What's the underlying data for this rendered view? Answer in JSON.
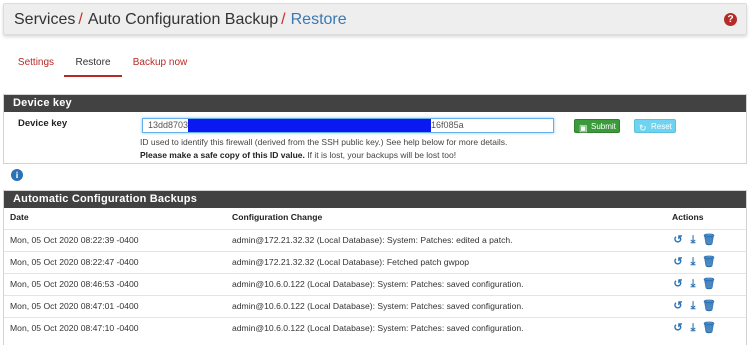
{
  "header": {
    "breadcrumbs": [
      "Services",
      "Auto Configuration Backup",
      "Restore"
    ],
    "help_icon": "question-circle-icon",
    "help_symbol": "?"
  },
  "tabs": [
    {
      "label": "Settings",
      "active": false
    },
    {
      "label": "Restore",
      "active": true
    },
    {
      "label": "Backup now",
      "active": false
    }
  ],
  "device_key": {
    "heading": "Device key",
    "label": "Device key",
    "value_start": "13dd8703",
    "value_end": "16f085a",
    "submit_label": "Submit",
    "reset_label": "Reset",
    "help_line1": "ID used to identify this firewall (derived from the SSH public key.) See help below for more details.",
    "help_line2_bold": "Please make a safe copy of this ID value.",
    "help_line2_rest": " If it is lost, your backups will be lost too!"
  },
  "backups": {
    "heading": "Automatic Configuration Backups",
    "columns": [
      "Date",
      "Configuration Change",
      "Actions"
    ],
    "rows": [
      {
        "date": "Mon, 05 Oct 2020 08:22:39 -0400",
        "change": "admin@172.21.32.32 (Local Database): System: Patches: edited a patch."
      },
      {
        "date": "Mon, 05 Oct 2020 08:22:47 -0400",
        "change": "admin@172.21.32.32 (Local Database): Fetched patch gwpop"
      },
      {
        "date": "Mon, 05 Oct 2020 08:46:53 -0400",
        "change": "admin@10.6.0.122 (Local Database): System: Patches: saved configuration."
      },
      {
        "date": "Mon, 05 Oct 2020 08:47:01 -0400",
        "change": "admin@10.6.0.122 (Local Database): System: Patches: saved configuration."
      },
      {
        "date": "Mon, 05 Oct 2020 08:47:10 -0400",
        "change": "admin@10.6.0.122 (Local Database): System: Patches: saved configuration."
      }
    ],
    "row_actions": [
      "restore-icon",
      "download-icon",
      "trash-icon"
    ]
  },
  "colors": {
    "accent_red": "#b52b27",
    "link_blue": "#3a79b2",
    "panel_heading": "#424242",
    "submit_green": "#3b9a3b",
    "reset_cyan": "#6ed3ef"
  }
}
